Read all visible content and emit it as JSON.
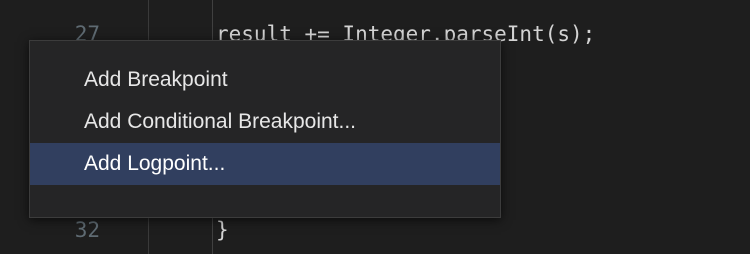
{
  "editor": {
    "line_numbers": {
      "top": "27",
      "bottom": "32"
    },
    "code": {
      "top": "result += Integer.parseInt(s);",
      "bottom": "}"
    }
  },
  "context_menu": {
    "items": [
      {
        "label": "Add Breakpoint"
      },
      {
        "label": "Add Conditional Breakpoint..."
      },
      {
        "label": "Add Logpoint..."
      }
    ],
    "selected_index": 2
  },
  "colors": {
    "editor_background": "#1e1e1e",
    "menu_background": "#252526",
    "selected_item_background": "#313f5f",
    "line_number": "#5f6b73",
    "code_text": "#d4d4d4"
  }
}
